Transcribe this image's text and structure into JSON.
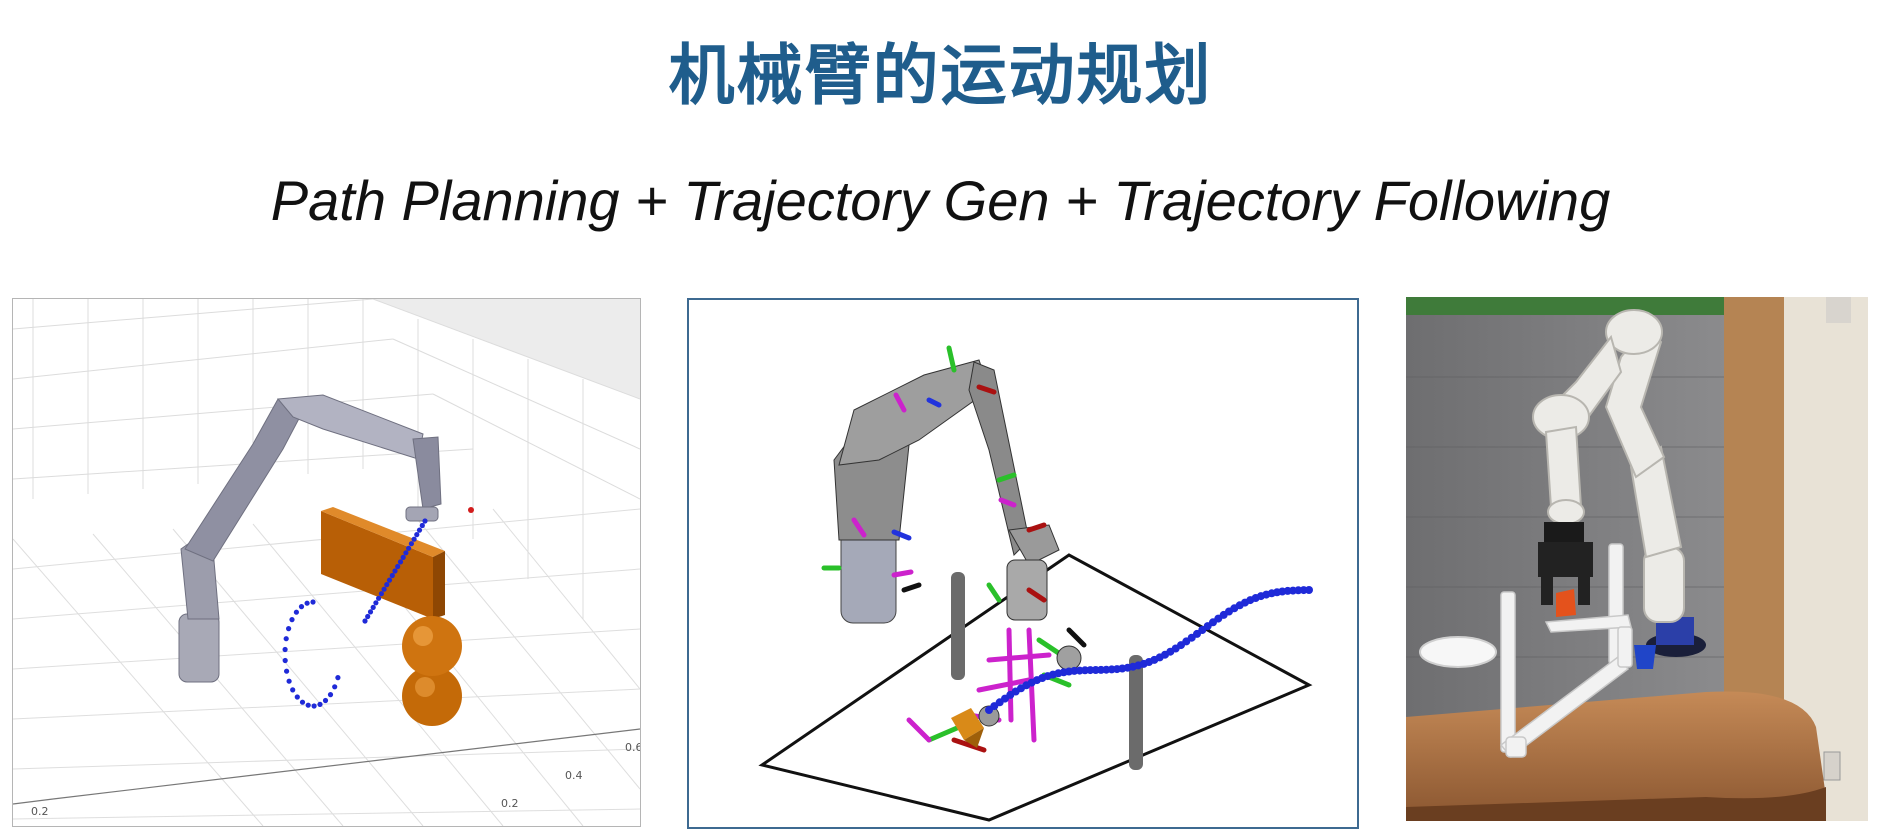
{
  "title": "机械臂的运动规划",
  "subtitle": "Path Planning + Trajectory Gen + Trajectory Following",
  "left_panel": {
    "tick_labels": [
      "0.2",
      "0.2",
      "0.4",
      "0.6"
    ]
  },
  "colors": {
    "title": "#1f5d8c",
    "trajectory_dots": "#1f2ad8",
    "obstacle": "#c8680a",
    "middle_panel_border": "#3e6a91"
  }
}
